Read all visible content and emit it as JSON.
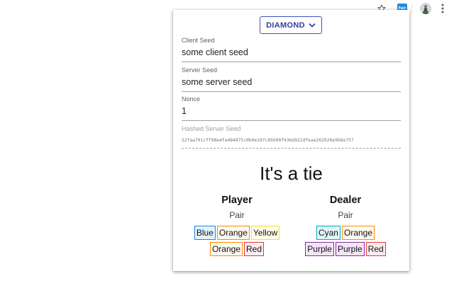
{
  "browser": {
    "icons": [
      "star-icon",
      "extension-icon",
      "avatar-icon",
      "menu-icon"
    ],
    "extension_badge": "Fair"
  },
  "popup": {
    "currency_label": "DIAMOND",
    "fields": {
      "client_seed": {
        "label": "Client Seed",
        "value": "some client seed"
      },
      "server_seed": {
        "label": "Server Seed",
        "value": "some server seed"
      },
      "nonce": {
        "label": "Nonce",
        "value": "1"
      },
      "hashed_server_seed": {
        "label": "Hashed Server Seed",
        "value": "52faa701cff98e4fa484875c0b0e107c85090f436d922dfeaa262026e9b8e757"
      }
    },
    "result": "It's a tie",
    "player": {
      "title": "Player",
      "hand": "Pair",
      "cards": [
        "Blue",
        "Orange",
        "Yellow",
        "Orange",
        "Red"
      ]
    },
    "dealer": {
      "title": "Dealer",
      "hand": "Pair",
      "cards": [
        "Cyan",
        "Orange",
        "Purple",
        "Purple",
        "Red"
      ]
    }
  },
  "colors": {
    "accent": "#3f51b5",
    "blue": "#1e88e5",
    "orange": "#fb8c00",
    "yellow": "#fdd835",
    "red": "#e53935",
    "cyan": "#00acc1",
    "purple": "#8e24aa"
  }
}
